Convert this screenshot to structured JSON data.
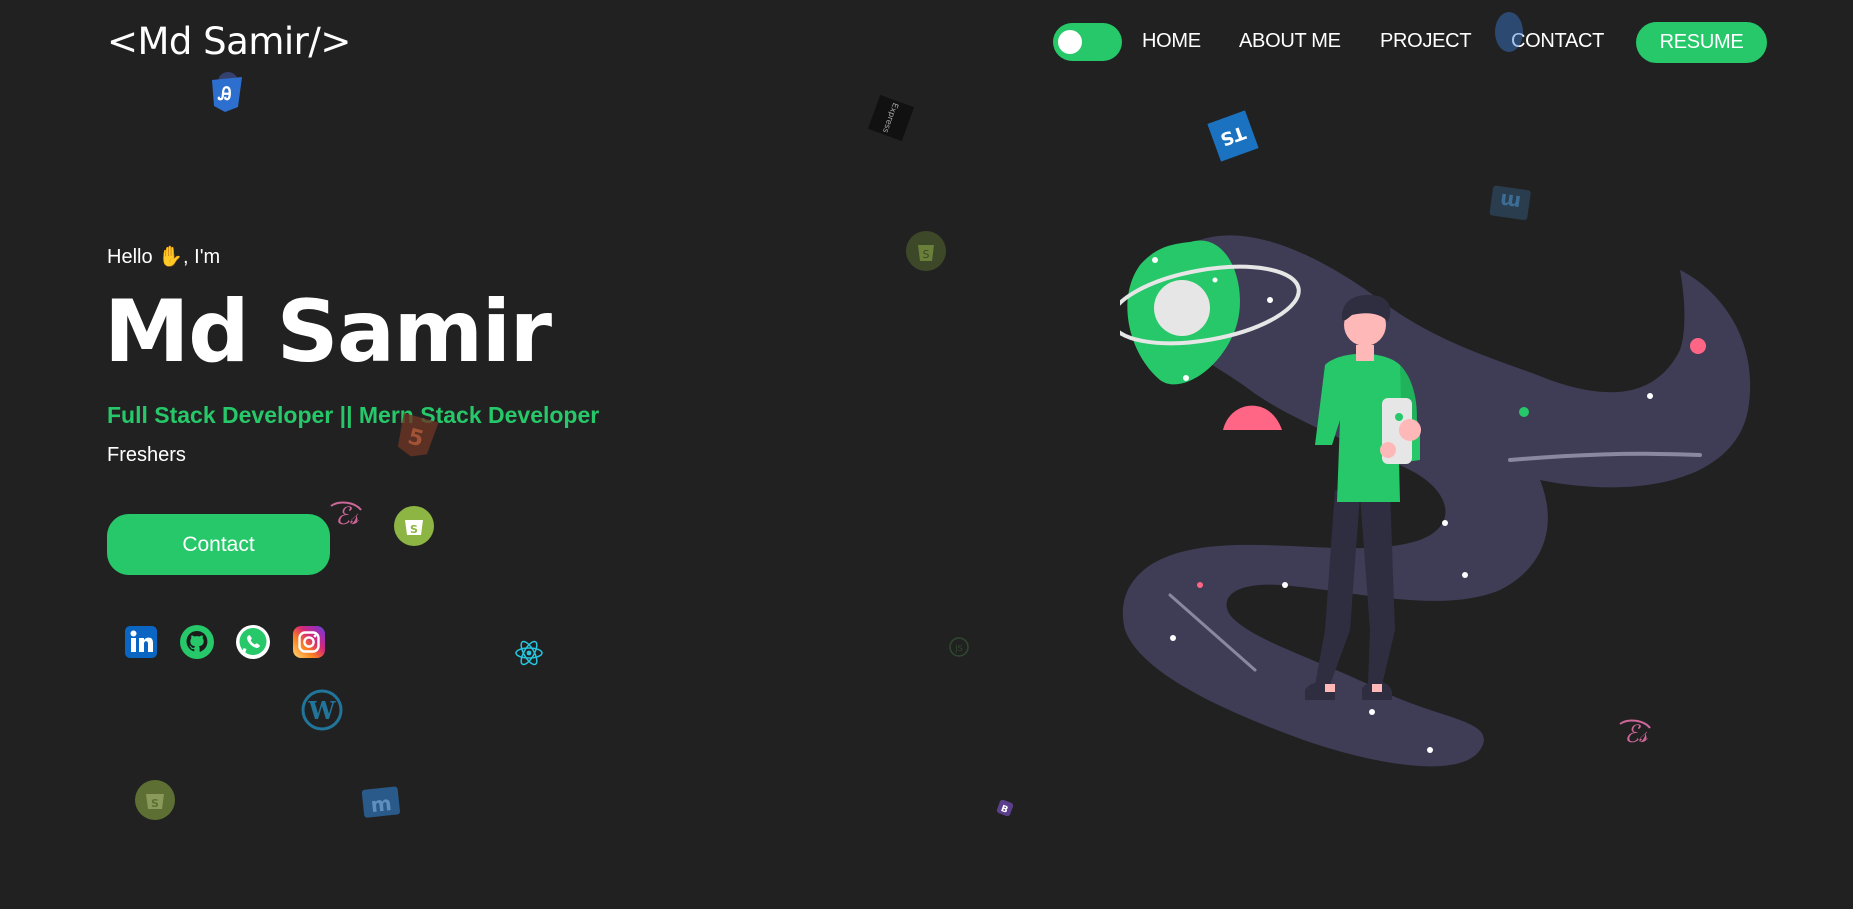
{
  "nav": {
    "logo": "<Md Samir/>",
    "theme_toggle": "dark-mode-toggle",
    "links": [
      "HOME",
      "ABOUT ME",
      "PROJECT",
      "CONTACT"
    ],
    "resume_label": "RESUME"
  },
  "hero": {
    "greeting_prefix": "Hello",
    "greeting_suffix": ", I'm",
    "name": "Md Samir",
    "role": "Full Stack Developer || Mern Stack Developer",
    "status": "Freshers",
    "contact_label": "Contact"
  },
  "socials": [
    "linkedin-icon",
    "github-icon",
    "whatsapp-icon",
    "instagram-icon"
  ],
  "floating_icons": [
    "css3-icon",
    "express-icon",
    "typescript-icon",
    "materialize-icon",
    "html5-icon",
    "sass-icon",
    "shopify-icon",
    "react-icon",
    "wordpress-icon",
    "nodejs-icon",
    "bootstrap-icon"
  ],
  "colors": {
    "background": "#212121",
    "accent": "#26c869",
    "illustration_band": "#3f3d56",
    "pink": "#ff6584"
  }
}
